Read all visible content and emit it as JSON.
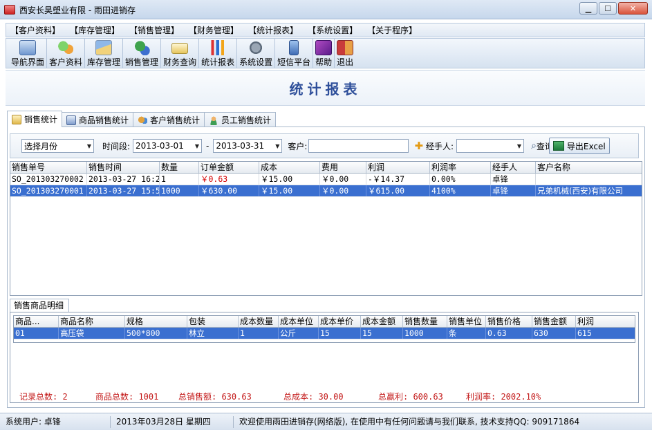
{
  "window": {
    "title": "西安长昊塑业有限 - 雨田进销存"
  },
  "menu": [
    "【客户资料】",
    "【库存管理】",
    "【销售管理】",
    "【财务管理】",
    "【统计报表】",
    "【系统设置】",
    "【关于程序】"
  ],
  "toolbar": [
    {
      "label": "导航界面",
      "icon": "home-screen-icon"
    },
    {
      "label": "客户资料",
      "icon": "customers-icon"
    },
    {
      "label": "库存管理",
      "icon": "warehouse-icon"
    },
    {
      "label": "销售管理",
      "icon": "sales-icon"
    },
    {
      "label": "财务查询",
      "icon": "finance-card-icon"
    },
    {
      "label": "统计报表",
      "icon": "bar-chart-icon"
    },
    {
      "label": "系统设置",
      "icon": "settings-tools-icon"
    },
    {
      "label": "短信平台",
      "icon": "sms-phone-icon"
    },
    {
      "label": "帮助",
      "icon": "help-book-icon"
    },
    {
      "label": "退出",
      "icon": "exit-door-icon"
    }
  ],
  "banner": {
    "title": "统计报表"
  },
  "tabs": [
    "销售统计",
    "商品销售统计",
    "客户销售统计",
    "员工销售统计"
  ],
  "filter": {
    "period_select": "选择月份",
    "time_label": "时间段:",
    "date_from": "2013-03-01",
    "dash": "-",
    "date_to": "2013-03-31",
    "customer_label": "客户:",
    "customer_value": "",
    "handler_label": "经手人:",
    "handler_value": "",
    "query_button": "查询",
    "export_button": "导出Excel"
  },
  "orders": {
    "columns": [
      "销售单号",
      "销售时间",
      "数量",
      "订单金额",
      "成本",
      "费用",
      "利润",
      "利润率",
      "经手人",
      "客户名称"
    ],
    "rows": [
      [
        "SO_201303270002",
        "2013-03-27 16:2",
        "1",
        "￥0.63",
        "￥15.00",
        "￥0.00",
        "-￥14.37",
        "0.00%",
        "卓锋",
        ""
      ],
      [
        "SO_201303270001",
        "2013-03-27 15:5",
        "1000",
        "￥630.00",
        "￥15.00",
        "￥0.00",
        "￥615.00",
        "4100%",
        "卓锋",
        "兄弟机械(西安)有限公司"
      ]
    ]
  },
  "detail": {
    "tab": "销售商品明细",
    "columns": [
      "商品...",
      "商品名称",
      "规格",
      "包装",
      "成本数量",
      "成本单位",
      "成本单价",
      "成本金额",
      "销售数量",
      "销售单位",
      "销售价格",
      "销售金额",
      "利润"
    ],
    "rows": [
      [
        "01",
        "高压袋",
        "500*800",
        "林立",
        "1",
        "公斤",
        "15",
        "15",
        "1000",
        "条",
        "0.63",
        "630",
        "615"
      ]
    ]
  },
  "summary": {
    "records": "记录总数: 2",
    "goods": "商品总数: 1001",
    "sales": "总销售额: 630.63",
    "cost": "总成本: 30.00",
    "profit": "总赢利: 600.63",
    "rate": "利润率: 2002.10%"
  },
  "status": {
    "user": "系统用户: 卓锋",
    "date": "2013年03月28日 星期四",
    "message": "欢迎使用雨田进销存(网络版), 在使用中有任何问题请与我们联系, 技术支持QQ: 909171864"
  },
  "colors": {
    "accent": "#2e4f9a",
    "selection": "#3a6fd0",
    "summary_red": "#c31818"
  }
}
